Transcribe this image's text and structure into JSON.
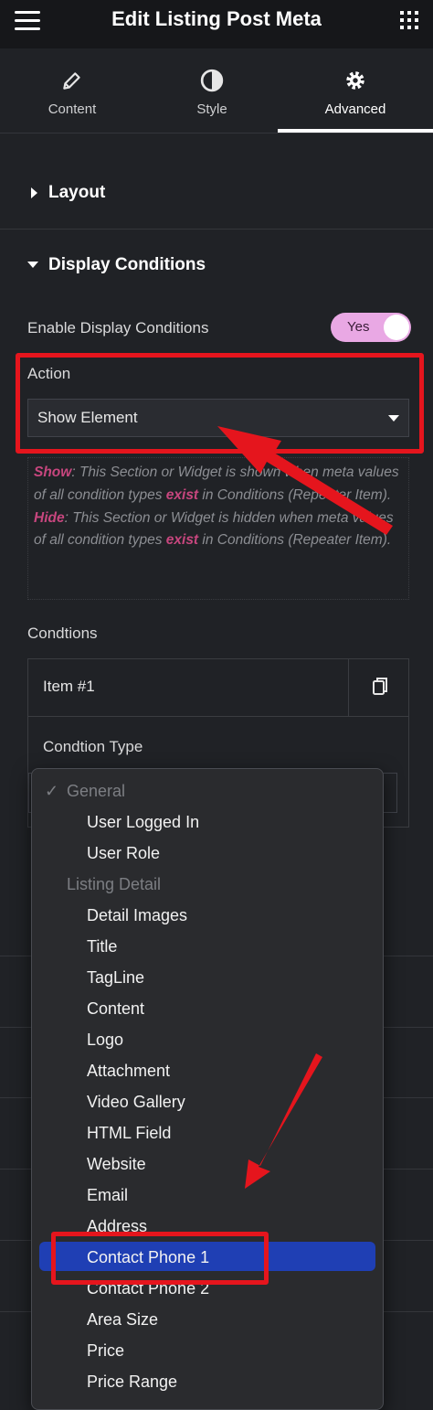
{
  "header": {
    "title": "Edit Listing Post Meta",
    "menu_icon": "hamburger-icon",
    "apps_icon": "grid-icon"
  },
  "tabs": [
    {
      "label": "Content",
      "icon": "pencil-icon",
      "active": false
    },
    {
      "label": "Style",
      "icon": "half-circle-icon",
      "active": false
    },
    {
      "label": "Advanced",
      "icon": "gear-icon",
      "active": true
    }
  ],
  "sections": {
    "layout": "Layout",
    "display_conditions": "Display Conditions"
  },
  "display_conditions": {
    "enable_label": "Enable Display Conditions",
    "toggle_label": "Yes",
    "action_label": "Action",
    "action_value": "Show Element",
    "description": {
      "show_word": "Show",
      "show_text_a": ": This Section or Widget is shown when meta values of all condition types ",
      "exist_1": "exist",
      "show_text_b": " in Conditions (Repeater Item).",
      "hide_word": "Hide",
      "hide_text_a": ": This Section or Widget is hidden when meta values of all condition types ",
      "exist_2": "exist",
      "hide_text_b": " in Conditions (Repeater Item)."
    },
    "conditions_label": "Condtions",
    "item_title": "Item #1",
    "condition_type_label": "Condtion Type"
  },
  "dropdown": {
    "checkmark": "✓",
    "group_general": "General",
    "general_items": [
      "User Logged In",
      "User Role"
    ],
    "group_listing": "Listing Detail",
    "listing_items": [
      "Detail Images",
      "Title",
      "TagLine",
      "Content",
      "Logo",
      "Attachment",
      "Video Gallery",
      "HTML Field",
      "Website",
      "Email",
      "Address",
      "Contact Phone 1",
      "Contact Phone 2",
      "Area Size",
      "Price",
      "Price Range"
    ],
    "selected": "Contact Phone 1"
  },
  "colors": {
    "accent_pink": "#c7467e",
    "toggle": "#e9a8e4",
    "highlight_blue": "#1f3fb4",
    "annotation_red": "#e5151d"
  }
}
